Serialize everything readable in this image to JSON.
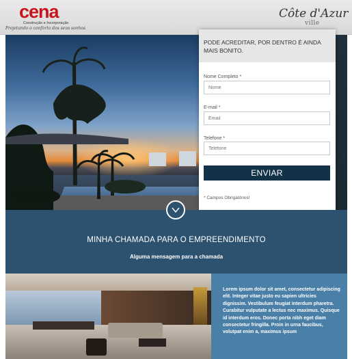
{
  "header": {
    "brand_logo": {
      "name": "cena",
      "subtitle": "Construção e Incorporação",
      "tagline": "Projetando o conforto dos seus sonhos"
    },
    "project_logo": {
      "name": "Côte d'Azur",
      "suffix": "ville"
    }
  },
  "form": {
    "headline": "PODE ACREDITAR, POR DENTRO É AINDA MAIS BONITO.",
    "fields": [
      {
        "label": "Nome Completo *",
        "placeholder": "Nome"
      },
      {
        "label": "E-mail *",
        "placeholder": "Email"
      },
      {
        "label": "Telefone *",
        "placeholder": "Telefone"
      }
    ],
    "submit_label": "ENVIAR",
    "required_note": "* Campos Obrigatórios!"
  },
  "scroll_icon": "chevron-down-icon",
  "section": {
    "title": "MINHA CHAMADA PARA O EMPREENDIMENTO",
    "subtitle": "Alguma mensagem para a chamada"
  },
  "lorem": "Lorem ipsum dolor sit amet, consectetur adipiscing elit. Integer vitae justo eu sapien ultricies dignissim. Vestibulum feugiat interdum pharetra. Curabitur vulputate a lectus nec maximus. Quisque id interdum eros. Donec porta nibh eget diam consectetur fringilla. Proin in urna faucibus, volutpat enim a, maximus ipsum",
  "colors": {
    "brand_red": "#c8141b",
    "band_blue": "#2c5270",
    "button_navy": "#123248",
    "text_box_blue": "#4a7fa8"
  }
}
